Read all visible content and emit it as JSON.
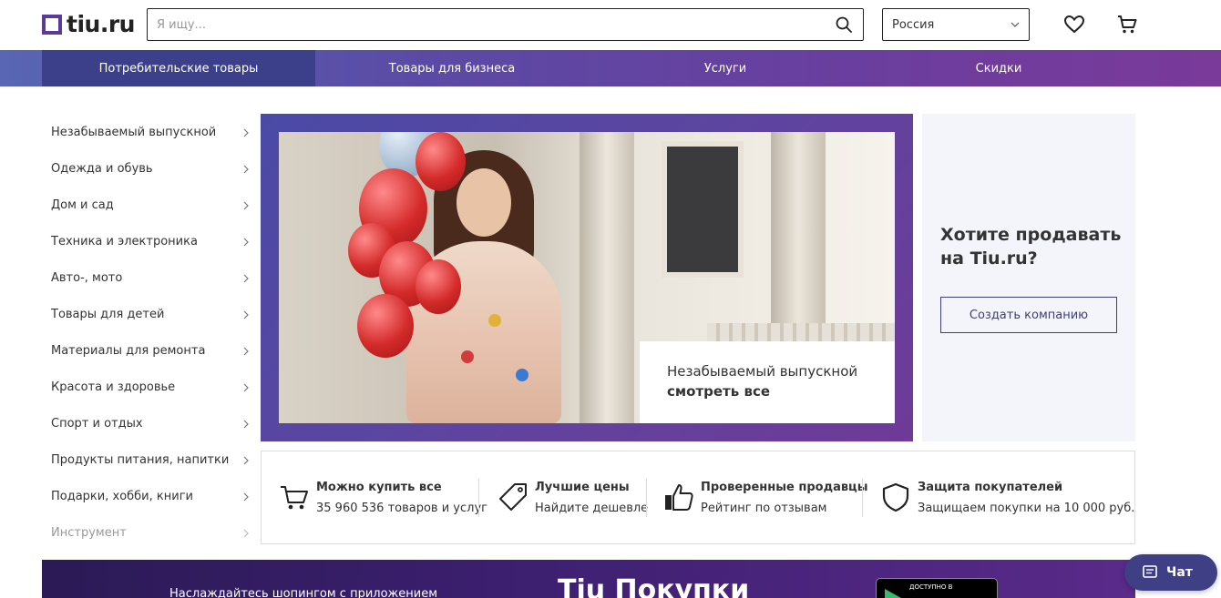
{
  "header": {
    "logo_text": "tiu.ru",
    "search_placeholder": "Я ищу...",
    "region_value": "Россия"
  },
  "nav": {
    "items": [
      {
        "label": "Потребительские товары",
        "active": true
      },
      {
        "label": "Товары для бизнеса"
      },
      {
        "label": "Услуги"
      },
      {
        "label": "Скидки"
      }
    ]
  },
  "sidebar": {
    "items": [
      {
        "label": "Незабываемый выпускной"
      },
      {
        "label": "Одежда и обувь"
      },
      {
        "label": "Дом и сад"
      },
      {
        "label": "Техника и электроника"
      },
      {
        "label": "Авто-, мото"
      },
      {
        "label": "Товары для детей"
      },
      {
        "label": "Материалы для ремонта"
      },
      {
        "label": "Красота и здоровье"
      },
      {
        "label": "Спорт и отдых"
      },
      {
        "label": "Продукты питания, напитки"
      },
      {
        "label": "Подарки, хобби, книги"
      },
      {
        "label": "Инструмент"
      }
    ]
  },
  "banner": {
    "title": "Незабываемый выпускной",
    "link": "смотреть все"
  },
  "sell": {
    "title": "Хотите продавать на Tiu.ru?",
    "button": "Создать компанию"
  },
  "features": [
    {
      "title": "Можно купить все",
      "sub": "35 960 536 товаров и услуг",
      "icon": "cart-icon"
    },
    {
      "title": "Лучшие цены",
      "sub": "Найдите дешевле",
      "icon": "price-tag-icon"
    },
    {
      "title": "Проверенные продавцы",
      "sub": "Рейтинг по отзывам",
      "icon": "thumbs-up-icon"
    },
    {
      "title": "Защита покупателей",
      "sub": "Защищаем покупки на 10 000 руб.",
      "icon": "shield-icon"
    }
  ],
  "promo": {
    "text": "Наслаждайтесь шопингом с приложением",
    "brand": "Tiu Покупки",
    "badge_small": "ДОСТУПНО В"
  },
  "chat": {
    "label": "Чат"
  },
  "colors": {
    "brand": "#5b3a9c",
    "nav_active": "#3c3f8a",
    "chat": "#3e3f85"
  }
}
